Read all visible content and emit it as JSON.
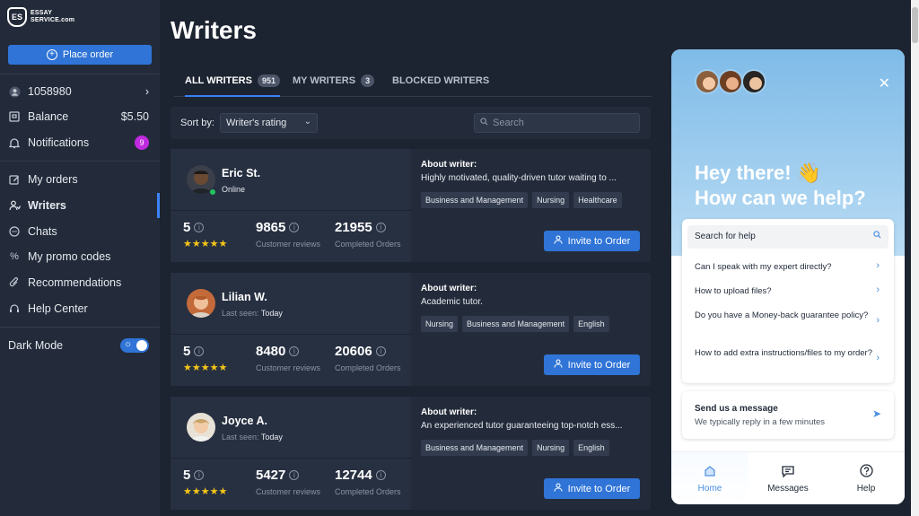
{
  "logo": {
    "mark": "ES",
    "line1": "ESSAY",
    "line2": "SERVICE.com"
  },
  "sidebar": {
    "place_order": "Place order",
    "account_id": "1058980",
    "balance_label": "Balance",
    "balance_value": "$5.50",
    "notifications_label": "Notifications",
    "notifications_count": "9",
    "items": [
      {
        "label": "My orders"
      },
      {
        "label": "Writers"
      },
      {
        "label": "Chats"
      },
      {
        "label": "My promo codes"
      },
      {
        "label": "Recommendations"
      },
      {
        "label": "Help Center"
      }
    ],
    "dark_mode": "Dark Mode"
  },
  "main": {
    "title": "Writers",
    "tabs": [
      {
        "label": "ALL WRITERS",
        "count": "951"
      },
      {
        "label": "MY WRITERS",
        "count": "3"
      },
      {
        "label": "BLOCKED WRITERS"
      }
    ],
    "sort_label": "Sort by:",
    "sort_value": "Writer's rating",
    "search_placeholder": "Search",
    "about_title": "About writer:",
    "invite_label": "Invite to Order",
    "reviews_label": "Customer reviews",
    "completed_label": "Completed Orders",
    "writers": [
      {
        "name": "Eric St.",
        "status": "Online",
        "seen_label": "",
        "rating": "5",
        "reviews": "9865",
        "completed": "21955",
        "about": "Highly motivated, quality-driven tutor waiting to ...",
        "tags": [
          "Business and Management",
          "Nursing",
          "Healthcare"
        ]
      },
      {
        "name": "Lilian W.",
        "status": "Today",
        "seen_label": "Last seen:",
        "rating": "5",
        "reviews": "8480",
        "completed": "20606",
        "about": "Academic tutor.",
        "tags": [
          "Nursing",
          "Business and Management",
          "English"
        ]
      },
      {
        "name": "Joyce A.",
        "status": "Today",
        "seen_label": "Last seen:",
        "rating": "5",
        "reviews": "5427",
        "completed": "12744",
        "about": "An experienced tutor guaranteeing top-notch ess...",
        "tags": [
          "Business and Management",
          "Nursing",
          "English"
        ]
      }
    ]
  },
  "widget": {
    "greeting_line1": "Hey there! 👋",
    "greeting_line2": "How can we help?",
    "search_label": "Search for help",
    "faq": [
      "Can I speak with my expert directly?",
      "How to upload files?",
      "Do you have a Money-back guarantee policy?",
      "How to add extra instructions/files to my order?"
    ],
    "message_title": "Send us a message",
    "message_sub": "We typically reply in a few minutes",
    "nav": [
      "Home",
      "Messages",
      "Help"
    ]
  },
  "colors": {
    "accent": "#2f74d6",
    "online": "#22c55e",
    "star": "#f5c518",
    "badge": "#c02ae0"
  }
}
